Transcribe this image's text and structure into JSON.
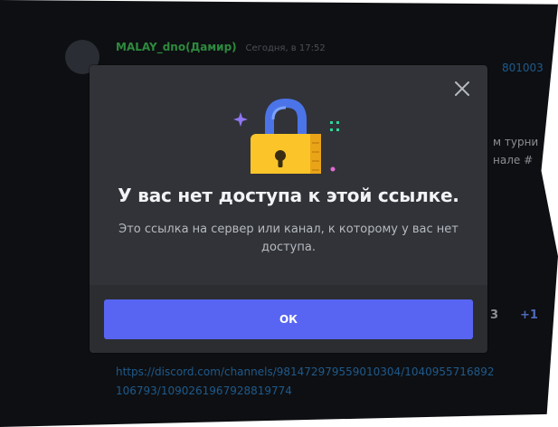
{
  "chat": {
    "author": "MALAY_dno(Дамир)",
    "timestamp": "Сегодня, в 17:52",
    "partial_link_top": "801003",
    "partial_text_1": "м турни",
    "partial_text_2": "нале #",
    "count_3": "3",
    "count_plus": "+1",
    "link_line_1": "https://discord.com/channels/981472979559010304/1040955716892",
    "link_line_2": "106793/1090261967928819774"
  },
  "modal": {
    "title": "У вас нет доступа к этой ссылке.",
    "description": "Это ссылка на сервер или канал, к которому у вас нет доступа.",
    "ok_label": "ОК",
    "lock_icon": "padlock-icon",
    "close_icon": "close-icon"
  },
  "colors": {
    "modal_bg": "#313338",
    "footer_bg": "#2b2d31",
    "button": "#5865f2",
    "lock_body": "#fbc52a",
    "lock_shackle": "#4b74e8"
  }
}
